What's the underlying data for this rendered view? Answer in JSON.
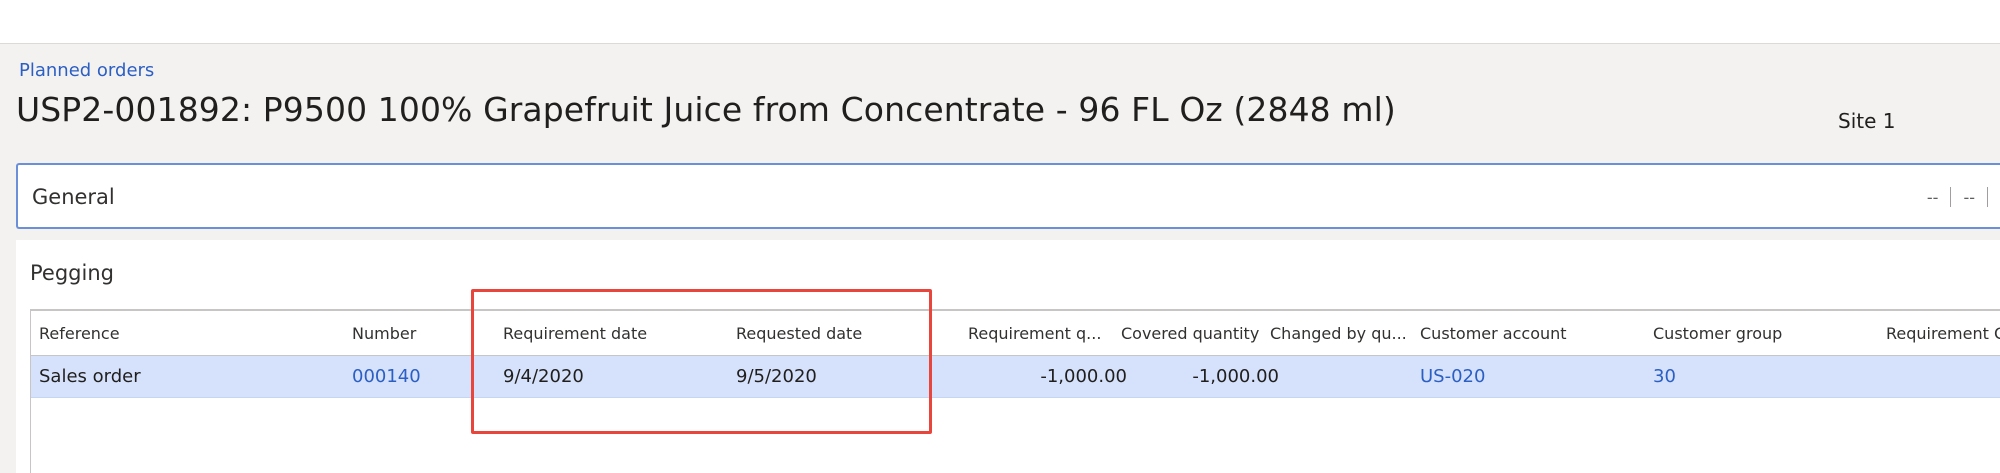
{
  "breadcrumb": "Planned orders",
  "page_title": "USP2-001892: P9500 100% Grapefruit Juice from Concentrate - 96 FL Oz (2848 ml)",
  "site_label": "Site 1",
  "general": {
    "title": "General",
    "summary_values": [
      "--",
      "--"
    ]
  },
  "pegging": {
    "title": "Pegging",
    "columns": [
      "Reference",
      "Number",
      "Requirement date",
      "Requested date",
      "Requirement q...",
      "Covered quantity",
      "Changed by qu...",
      "Customer account",
      "Customer group",
      "Requirement C"
    ],
    "rows": [
      {
        "reference": "Sales order",
        "number": "000140",
        "requirement_date": "9/4/2020",
        "requested_date": "9/5/2020",
        "requirement_quantity": "-1,000.00",
        "covered_quantity": "-1,000.00",
        "changed_by_quantity": "",
        "customer_account": "US-020",
        "customer_group": "30",
        "requirement_c": ""
      }
    ]
  },
  "colors": {
    "link": "#2b5fc4",
    "selected_row": "#d6e2fb",
    "focus_border": "#6b8fd9",
    "highlight_annotation": "#e8453c"
  }
}
